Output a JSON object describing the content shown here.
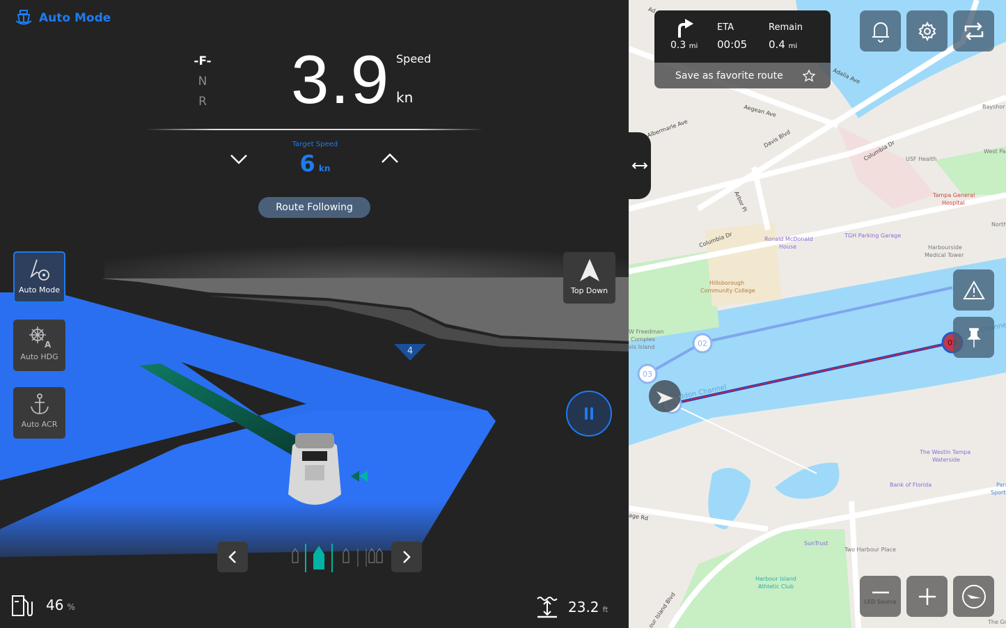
{
  "header": {
    "title": "Auto Mode",
    "icon": "boat-helm-icon"
  },
  "gear": {
    "forward": "F",
    "neutral": "N",
    "reverse": "R",
    "selected": "F"
  },
  "speed": {
    "value": "3.9",
    "label": "Speed",
    "unit": "kn"
  },
  "target_speed": {
    "label": "Target Speed",
    "value": "6",
    "unit": "kn"
  },
  "route_button": "Route Following",
  "modes": [
    {
      "label": "Auto Mode",
      "icon": "auto-mode-icon",
      "active": true
    },
    {
      "label": "Auto HDG",
      "icon": "helm-wheel-icon",
      "active": false
    },
    {
      "label": "Auto ACR",
      "icon": "anchor-icon",
      "active": false
    }
  ],
  "view_button": "Top Down",
  "waypoint_marker": "4",
  "camera_views": {
    "count": 5,
    "selected": 1
  },
  "fuel": {
    "value": "46",
    "unit": "%"
  },
  "depth": {
    "value": "23.2",
    "unit": "ft"
  },
  "colors": {
    "accent": "#1e7bf0",
    "route": "#2a6ff0",
    "teal": "#00b3a4",
    "water": "#9fd9f9"
  },
  "nav": {
    "turn_distance": "0.3",
    "turn_unit": "mi",
    "eta_label": "ETA",
    "eta": "00:05",
    "remain_label": "Remain",
    "remain": "0.4",
    "remain_unit": "mi",
    "favorite": "Save as favorite route"
  },
  "map": {
    "waypoints": [
      "02",
      "03",
      "04",
      "05"
    ],
    "labels": {
      "adalia1": "Ad",
      "adalia2": "Adalia Ave",
      "aegean": "Aegean Ave",
      "albermarle": "Albermarle Ave",
      "davis": "Davis Blvd",
      "columbia1": "Columbia Dr",
      "columbia2": "Columbia Dr",
      "arbor": "Arbor Pl",
      "usf": "USF Health",
      "bayshore": "Bayshor",
      "westpav": "West Pav",
      "tgh1": "Tampa General",
      "tgh2": "Hospital",
      "north": "North",
      "tghpark": "TGH Parking Garage",
      "rmh1": "Ronald McDonald",
      "rmh2": "House",
      "hmt1": "Harbourside",
      "hmt2": "Medical Tower",
      "hcc1": "Hillsborough",
      "hcc2": "Community College",
      "wf1": "W Freedman",
      "wf2": "Complex",
      "wf3": "vis Island",
      "seddon1": "ddon Channel",
      "seddon2": "Channel",
      "westin1": "The Westin Tampa",
      "westin2": "Waterside",
      "bof": "Bank of Florida",
      "para1": "Para",
      "para2": "Sports",
      "suntrust": "SunTrust",
      "thp": "Two Harbour Place",
      "hiac1": "Harbour Island",
      "hiac2": "Athletic Club",
      "agerd": "age Rd",
      "hib": "our Island Blvd",
      "thegr": "The Gr",
      "led": "LED Source"
    }
  }
}
